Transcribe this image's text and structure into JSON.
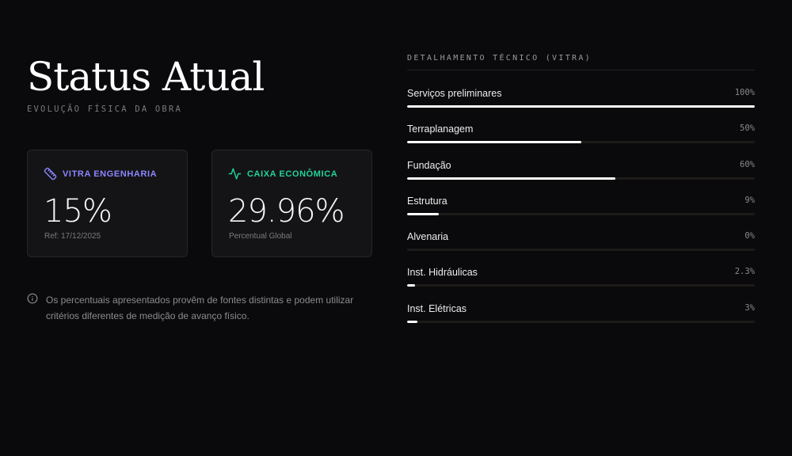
{
  "header": {
    "title": "Status Atual",
    "subtitle": "EVOLUÇÃO FÍSICA DA OBRA"
  },
  "cards": [
    {
      "label": "VITRA ENGENHARIA",
      "icon": "ruler-icon",
      "color": "#8b86ff",
      "value": "15%",
      "note": "Ref: 17/12/2025"
    },
    {
      "label": "CAIXA ECONÔMICA",
      "icon": "activity-pulse-icon",
      "color": "#22d39a",
      "value": "29.96%",
      "note": "Percentual Global"
    }
  ],
  "notice": {
    "icon": "info-icon",
    "text": "Os percentuais apresentados provêm de fontes distintas e podem utilizar critérios diferentes de medição de avanço físico."
  },
  "details": {
    "title": "DETALHAMENTO TÉCNICO (VITRA)",
    "items": [
      {
        "name": "Serviços preliminares",
        "percent_label": "100%",
        "progress": 100
      },
      {
        "name": "Terraplanagem",
        "percent_label": "50%",
        "progress": 50
      },
      {
        "name": "Fundação",
        "percent_label": "60%",
        "progress": 60
      },
      {
        "name": "Estrutura",
        "percent_label": "9%",
        "progress": 9
      },
      {
        "name": "Alvenaria",
        "percent_label": "0%",
        "progress": 0
      },
      {
        "name": "Inst. Hidráulicas",
        "percent_label": "2.3%",
        "progress": 2.3
      },
      {
        "name": "Inst. Elétricas",
        "percent_label": "3%",
        "progress": 3
      }
    ]
  }
}
